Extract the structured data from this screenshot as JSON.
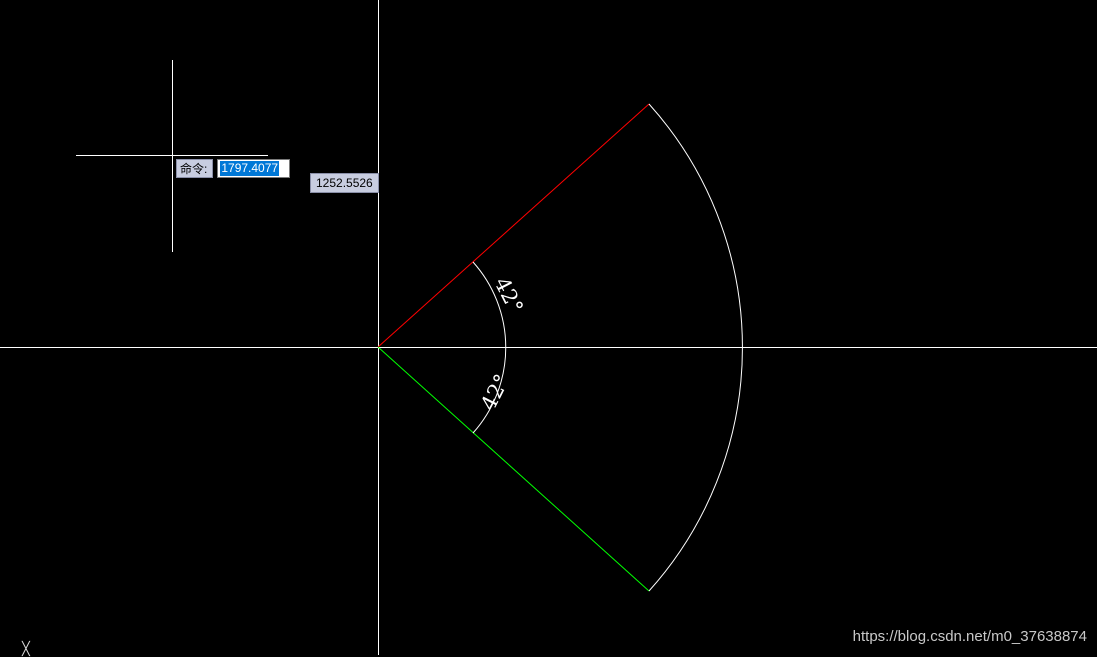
{
  "app": {
    "background_color": "#000000",
    "crosshair_color": "#ffffff"
  },
  "command_line": {
    "label": "命令:",
    "input_value": "1797.4077",
    "selection_color": "#0078d7"
  },
  "coordinate_tooltip": {
    "value": "1252.5526"
  },
  "drawing": {
    "upper_line_color": "#ff0000",
    "lower_line_color": "#00ff00",
    "arc_color": "#ffffff",
    "dimension_upper": "42°",
    "dimension_lower": "42°"
  },
  "ucs": {
    "icon": "ucs-axis-icon"
  },
  "watermark": {
    "text": "https://blog.csdn.net/m0_37638874"
  }
}
